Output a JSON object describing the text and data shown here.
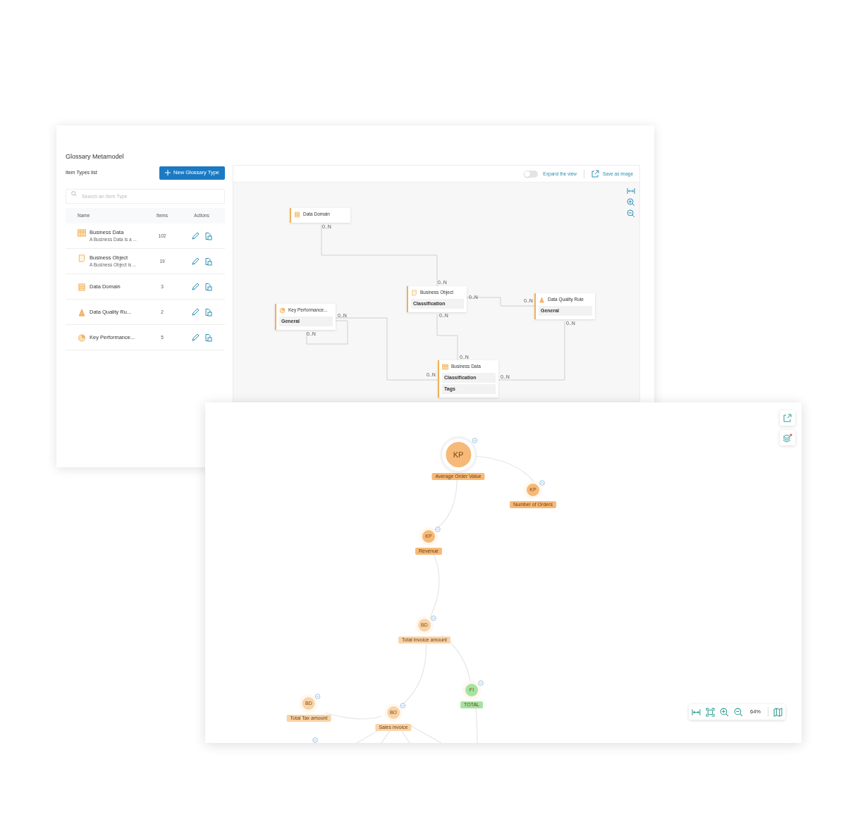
{
  "metamodel_window": {
    "title": "Glossary Metamodel",
    "list_title": "Item Types list",
    "new_button": "New Glossary Type",
    "search": {
      "placeholder": "Search an Item Type"
    },
    "table": {
      "columns": [
        "Name",
        "Items",
        "Actions"
      ],
      "rows": [
        {
          "kind": "data",
          "name": "Business Data",
          "description": "A Business Data is a ...",
          "items": "102"
        },
        {
          "kind": "object",
          "name": "Business Object",
          "description": "A Business Object is ...",
          "items": "19"
        },
        {
          "kind": "domain",
          "name": "Data Domain",
          "items": "3"
        },
        {
          "kind": "rule",
          "name": "Data Quality Ru...",
          "items": "2"
        },
        {
          "kind": "kpi",
          "name": "Key Performance...",
          "items": "5"
        }
      ]
    }
  },
  "diagram": {
    "expand_toggle": {
      "label": "Expand the view",
      "on": false
    },
    "save_label": "Save as image",
    "nodes": [
      {
        "kind": "domain",
        "title": "Data Domain"
      },
      {
        "kind": "object",
        "title": "Business Object",
        "fields": [
          "Classification"
        ]
      },
      {
        "kind": "rule",
        "title": "Data Quality Rule",
        "fields": [
          "General"
        ]
      },
      {
        "kind": "kpi",
        "title": "Key Performance...",
        "fields": [
          "General"
        ]
      },
      {
        "kind": "data",
        "title": "Business Data",
        "fields": [
          "Classification",
          "Tags"
        ]
      }
    ],
    "edge_labels": [
      "0..N",
      "0..N",
      "0..N",
      "0..N",
      "0..N",
      "0..N",
      "0..N",
      "0..N",
      "0..N",
      "0..N",
      "0..N"
    ]
  },
  "graph": {
    "nodes": [
      {
        "abbr": "KP",
        "label": "Average Order Value",
        "color": "#f7b977",
        "selected": true
      },
      {
        "abbr": "KP",
        "label": "Number of Orders",
        "color": "#f7b977",
        "selected": false
      },
      {
        "abbr": "KP",
        "label": "Revenue",
        "color": "#f7b977",
        "selected": false
      },
      {
        "abbr": "BD",
        "label": "Total invoice amount",
        "color": "#f9d3a8",
        "selected": false
      },
      {
        "abbr": "FI",
        "label": "TOTAL",
        "color": "#a6e3a1",
        "selected": false
      },
      {
        "abbr": "BD",
        "label": "Total Tax amount",
        "color": "#f9d3a8",
        "selected": false
      },
      {
        "abbr": "BO",
        "label": "Sales invoice",
        "color": "#f9d3a8",
        "selected": false
      }
    ],
    "zoom": "64%"
  }
}
